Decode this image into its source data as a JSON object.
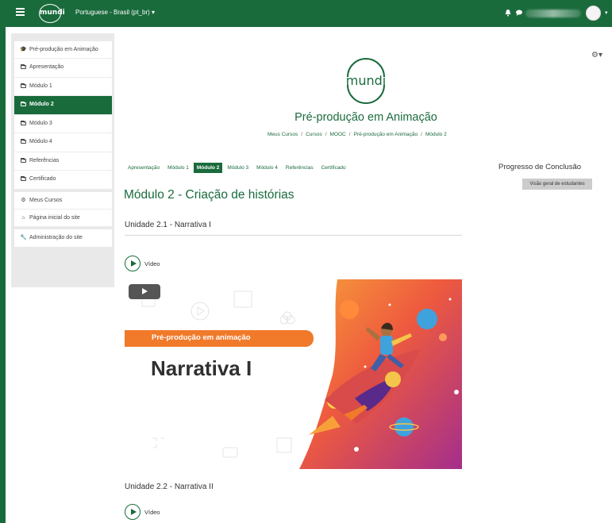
{
  "navbar": {
    "logo_text": "mundi",
    "language": "Portuguese - Brasil (pt_br) ▾"
  },
  "sidebar": {
    "course_items": [
      {
        "label": "Pré-produção em Animação",
        "icon": "graduation-cap-icon",
        "active": false
      },
      {
        "label": "Apresentação",
        "icon": "folder-icon",
        "active": false
      },
      {
        "label": "Módulo 1",
        "icon": "folder-icon",
        "active": false
      },
      {
        "label": "Módulo 2",
        "icon": "folder-icon",
        "active": true
      },
      {
        "label": "Módulo 3",
        "icon": "folder-icon",
        "active": false
      },
      {
        "label": "Módulo 4",
        "icon": "folder-icon",
        "active": false
      },
      {
        "label": "Referências",
        "icon": "folder-icon",
        "active": false
      },
      {
        "label": "Certificado",
        "icon": "folder-icon",
        "active": false
      }
    ],
    "site_items": [
      {
        "label": "Meus Cursos",
        "icon": "dashboard-icon"
      },
      {
        "label": "Página inicial do site",
        "icon": "home-icon"
      }
    ],
    "admin_item": {
      "label": "Administração do site",
      "icon": "wrench-icon"
    }
  },
  "header": {
    "logo_text": "mundi",
    "course_title": "Pré-produção em Animação",
    "breadcrumb": [
      "Meus Cursos",
      "Cursos",
      "MOOC",
      "Pré-produção em Animação",
      "Módulo 2"
    ]
  },
  "tabs": [
    {
      "label": "Apresentação",
      "active": false
    },
    {
      "label": "Módulo 1",
      "active": false
    },
    {
      "label": "Módulo 2",
      "active": true
    },
    {
      "label": "Módulo 3",
      "active": false
    },
    {
      "label": "Módulo 4",
      "active": false
    },
    {
      "label": "Referências",
      "active": false
    },
    {
      "label": "Certificado",
      "active": false
    }
  ],
  "main": {
    "module_title": "Módulo 2 - Criação de histórias",
    "unit1_title": "Unidade 2.1 - Narrativa I",
    "video_label": "Vídeo",
    "thumb_banner": "Pré-produção em animação",
    "thumb_title": "Narrativa I",
    "unit2_title": "Unidade 2.2 - Narrativa II",
    "video2_label": "Vídeo"
  },
  "progress": {
    "title": "Progresso de Conclusão",
    "button": "Visão geral de estudantes"
  },
  "colors": {
    "brand_green": "#1a6b3c",
    "orange": "#f07a2a",
    "magenta": "#c2307a"
  }
}
